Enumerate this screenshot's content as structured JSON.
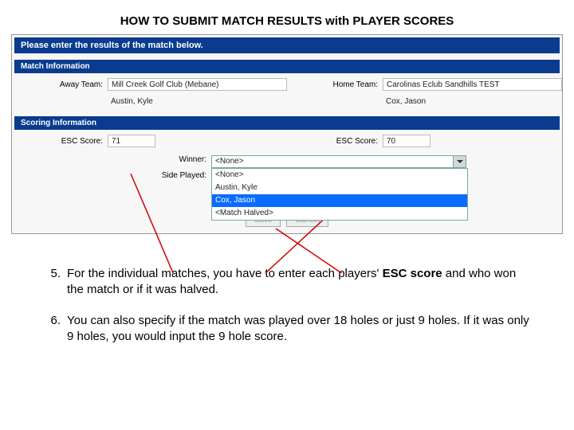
{
  "title": "HOW TO SUBMIT MATCH RESULTS with PLAYER SCORES",
  "panel": {
    "instruction": "Please enter the results of the match below.",
    "section_match": "Match Information",
    "away_team_label": "Away Team:",
    "away_team_value": "Mill Creek Golf Club (Mebane)",
    "away_player": "Austin, Kyle",
    "home_team_label": "Home Team:",
    "home_team_value": "Carolinas Eclub Sandhills TEST",
    "home_player": "Cox, Jason",
    "section_scoring": "Scoring Information",
    "esc_label": "ESC Score:",
    "esc_away": "71",
    "esc_home": "70",
    "winner_label": "Winner:",
    "winner_value": "<None>",
    "side_label": "Side Played:",
    "dropdown": {
      "opt0": "<None>",
      "opt1": "Austin, Kyle",
      "opt2": "Cox, Jason",
      "opt3": "<Match Halved>"
    },
    "btn_save": "Save",
    "btn_cancel": "Cancel"
  },
  "steps": {
    "n5": "5.",
    "t5a": "For the individual matches, you have to enter each players' ",
    "t5b": "ESC score",
    "t5c": " and who won the match or if it was halved.",
    "n6": "6.",
    "t6": "You can also specify if the match was played over 18 holes or just 9 holes. If it was only 9 holes, you would input the 9 hole score."
  }
}
